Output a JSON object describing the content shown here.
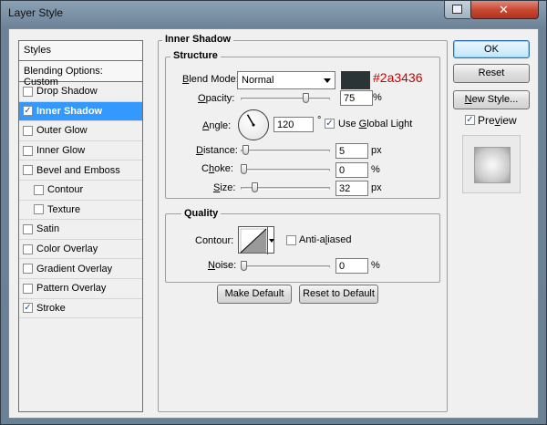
{
  "window": {
    "title": "Layer Style"
  },
  "colors": {
    "selection": "#3399ff",
    "shadow_swatch": "#2a3436",
    "hex_label": "#cc0000"
  },
  "list": {
    "header": "Styles",
    "blending": "Blending Options: Custom",
    "items": [
      {
        "label": "Drop Shadow",
        "checked": false
      },
      {
        "label": "Inner Shadow",
        "checked": true
      },
      {
        "label": "Outer Glow",
        "checked": false
      },
      {
        "label": "Inner Glow",
        "checked": false
      },
      {
        "label": "Bevel and Emboss",
        "checked": false
      },
      {
        "label": "Contour",
        "checked": false
      },
      {
        "label": "Texture",
        "checked": false
      },
      {
        "label": "Satin",
        "checked": false
      },
      {
        "label": "Color Overlay",
        "checked": false
      },
      {
        "label": "Gradient Overlay",
        "checked": false
      },
      {
        "label": "Pattern Overlay",
        "checked": false
      },
      {
        "label": "Stroke",
        "checked": true
      }
    ]
  },
  "inner_shadow": {
    "title": "Inner Shadow",
    "structure": {
      "title": "Structure",
      "blend_mode_label_first": "B",
      "blend_mode_label_rest": "lend Mode:",
      "blend_mode_value": "Normal",
      "hex_label": "#2a3436",
      "opacity_label_first": "O",
      "opacity_label_rest": "pacity:",
      "opacity_value": "75",
      "opacity_level": 0.75,
      "percent": "%",
      "angle_label_first": "A",
      "angle_label_rest": "ngle:",
      "angle_value": "120",
      "degree": "°",
      "use_global_light_first": "G",
      "use_global_light_before": "Use ",
      "use_global_light_rest": "lobal Light",
      "use_global_light_checked": true,
      "distance_label_first": "D",
      "distance_label_rest": "istance:",
      "distance_value": "5",
      "distance_level": 0.02,
      "px": "px",
      "choke_label_before": "C",
      "choke_label_first": "h",
      "choke_label_rest": "oke:",
      "choke_value": "0",
      "choke_level": 0.0,
      "size_label_first": "S",
      "size_label_rest": "ize:",
      "size_value": "32",
      "size_level": 0.13
    },
    "quality": {
      "title": "Quality",
      "contour_label": "Contour:",
      "anti_aliased_before": "Anti-a",
      "anti_aliased_first": "l",
      "anti_aliased_rest": "iased",
      "anti_aliased_checked": false,
      "noise_label_first": "N",
      "noise_label_rest": "oise:",
      "noise_value": "0",
      "noise_level": 0.0,
      "percent": "%"
    },
    "make_default": "Make Default",
    "reset_default": "Reset to Default"
  },
  "buttons": {
    "ok": "OK",
    "reset": "Reset",
    "new_style_first": "N",
    "new_style_rest": "ew Style...",
    "preview_first": "v",
    "preview_before": "Pre",
    "preview_rest": "iew",
    "preview_checked": true
  }
}
